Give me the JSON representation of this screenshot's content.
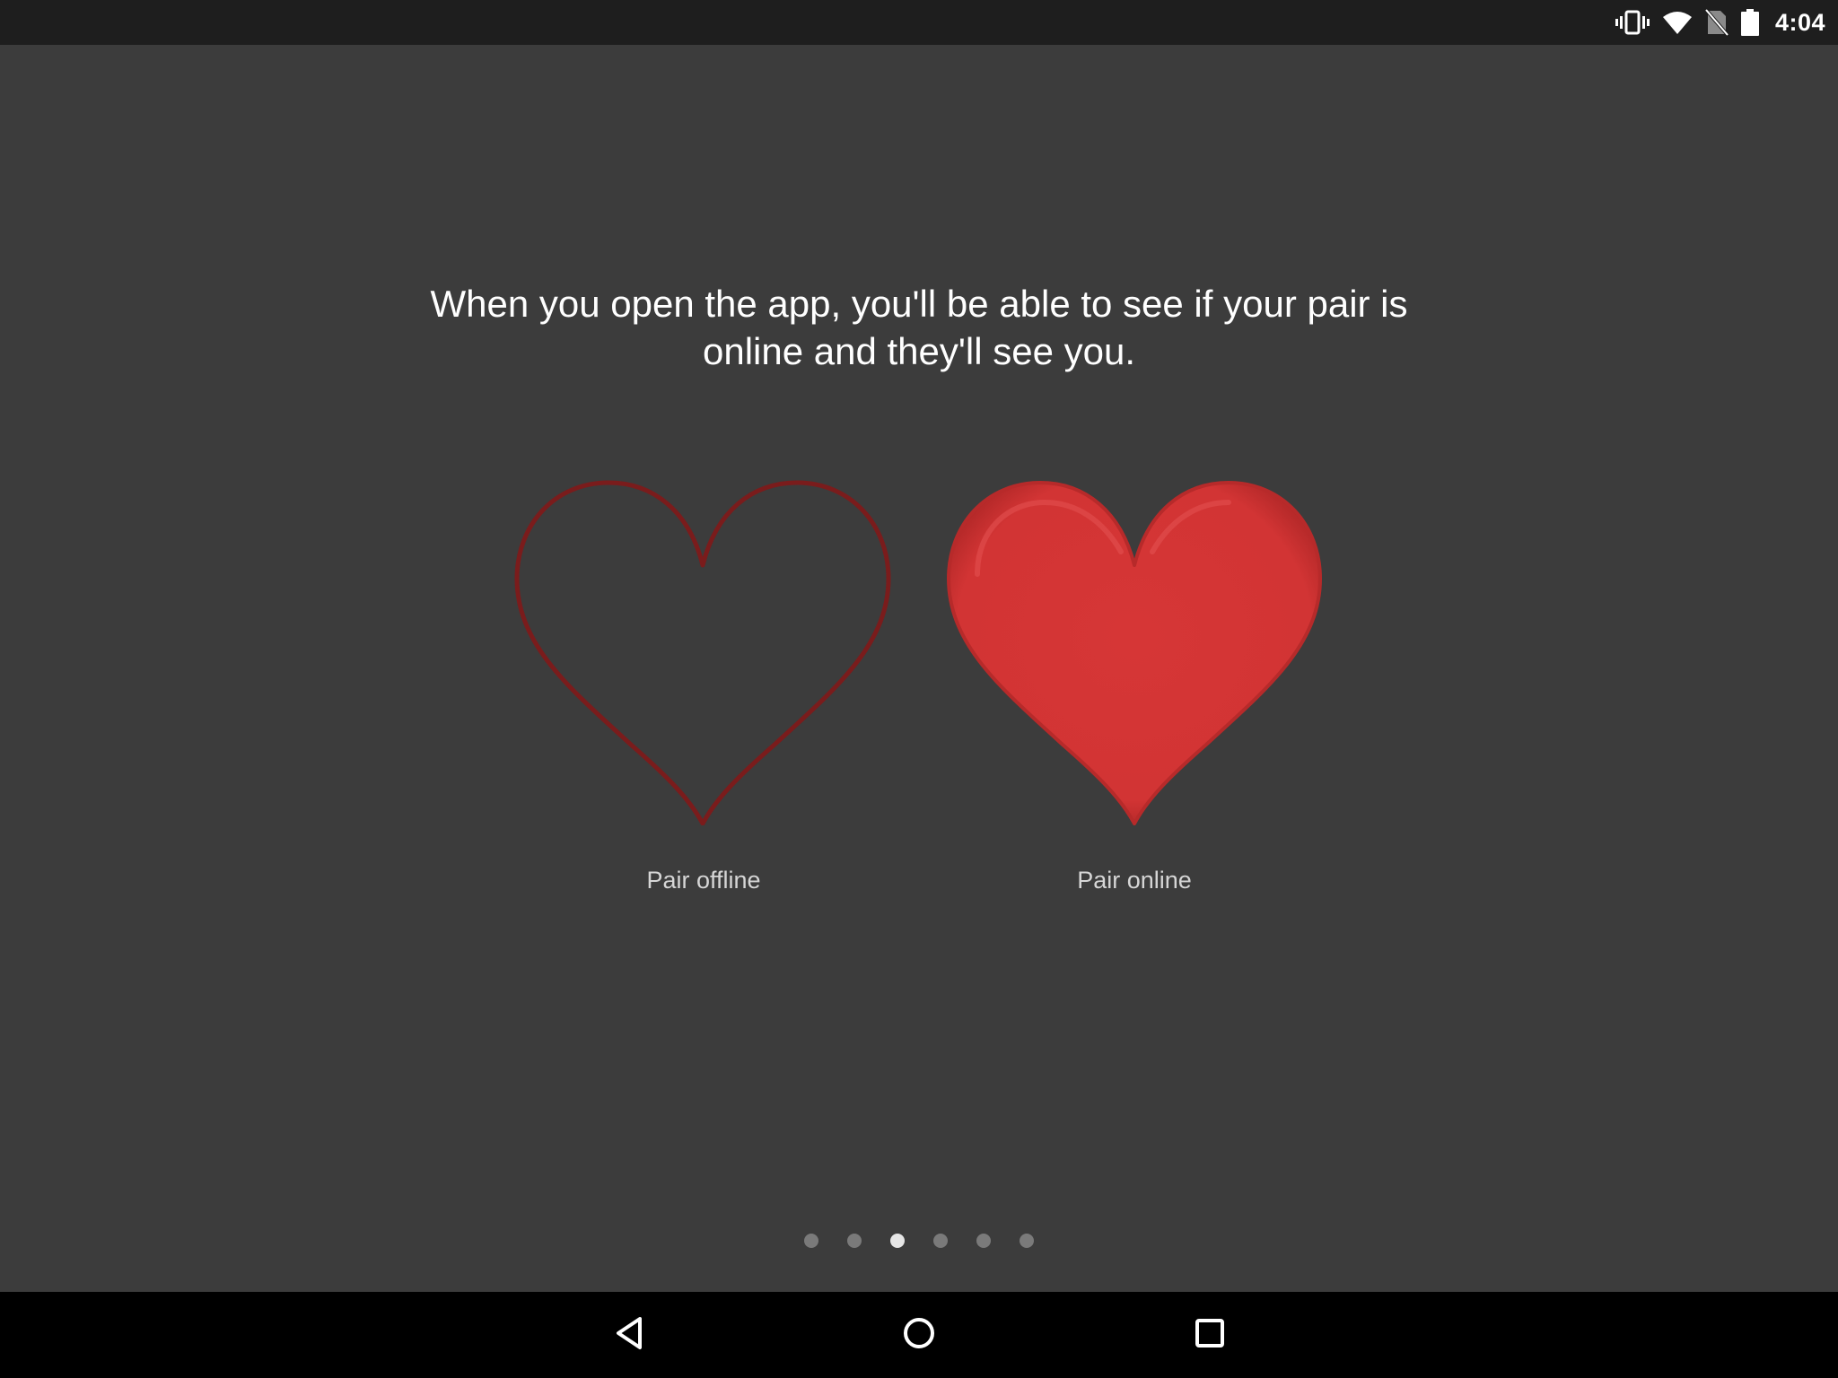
{
  "status_bar": {
    "time": "4:04",
    "icons": [
      "vibrate-icon",
      "wifi-icon",
      "no-sim-icon",
      "battery-icon"
    ]
  },
  "content": {
    "headline": "When you open the app, you'll be able to see if your pair is online and they'll see you.",
    "offline_label": "Pair offline",
    "online_label": "Pair online"
  },
  "page_indicator": {
    "count": 6,
    "active_index": 2
  },
  "nav_bar": {
    "icons": [
      "back-icon",
      "home-icon",
      "recents-icon"
    ]
  },
  "colors": {
    "background": "#3c3c3c",
    "status_bar": "#1e1e1e",
    "nav_bar": "#000000",
    "heart_outline": "#7a1c1c",
    "heart_fill": "#d23434"
  }
}
